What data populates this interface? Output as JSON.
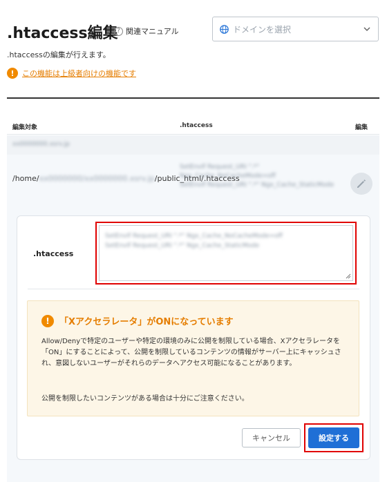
{
  "header": {
    "title": ".htaccess編集",
    "help_label": "関連マニュアル",
    "domain_placeholder": "ドメインを選択"
  },
  "intro": {
    "description": ".htaccessの編集が行えます。",
    "advanced_link": "この機能は上級者向けの機能です"
  },
  "table": {
    "columns": [
      "編集対象",
      ".htaccess",
      "編集"
    ],
    "domain": "xx0000000.xsrv.jp",
    "path_prefix": "/home/",
    "path_hidden": "xx0000000/xx0000000.xsrv.jp",
    "path_suffix": "/public_html/.htaccess",
    "preview_lines": [
      "SetEnvIf Request_URI \".*\" Ngx_Cache_NoCacheMode=off",
      "SetEnvIf Request_URI \".*\" Ngx_Cache_StaticMode"
    ]
  },
  "editor": {
    "label": ".htaccess",
    "content_lines": [
      "SetEnvIf Request_URI \".*\" Ngx_Cache_NoCacheMode=off",
      "SetEnvIf Request_URI \".*\" Ngx_Cache_StaticMode"
    ]
  },
  "notice": {
    "title": "「Xアクセラレータ」がONになっています",
    "body": "Allow/Denyで特定のユーザーや特定の環境のみに公開を制限している場合、Xアクセラレータを「ON」にすることによって、公開を制限しているコンテンツの情報がサーバー上にキャッシュされ、意図しないユーザーがそれらのデータへアクセス可能になることがあります。",
    "body2": "公開を制限したいコンテンツがある場合は十分にご注意ください。"
  },
  "actions": {
    "cancel": "キャンセル",
    "submit": "設定する"
  },
  "colors": {
    "accent": "#1f6fd6",
    "warning": "#e57d00",
    "highlight": "#e00000"
  }
}
